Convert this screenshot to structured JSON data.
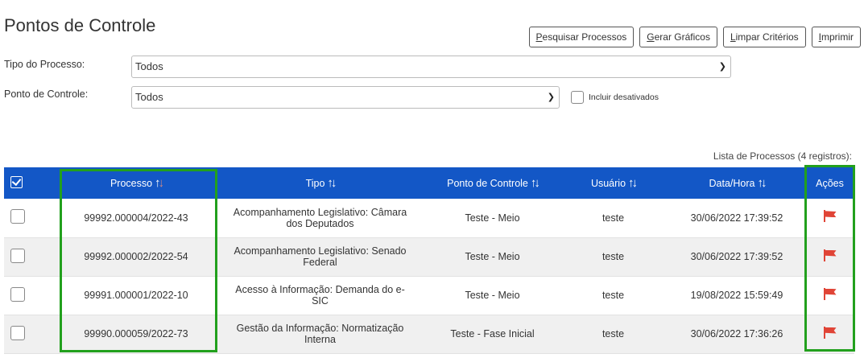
{
  "page": {
    "title": "Pontos de Controle"
  },
  "toolbar": {
    "buttons": [
      {
        "key": "P",
        "rest": "esquisar Processos",
        "name": "search-processes-button"
      },
      {
        "key": "G",
        "rest": "erar Gráficos",
        "name": "generate-charts-button"
      },
      {
        "key": "L",
        "rest": "impar Critérios",
        "name": "clear-criteria-button"
      },
      {
        "key": "I",
        "rest": "mprimir",
        "name": "print-button"
      }
    ]
  },
  "filters": {
    "tipo_label": "Tipo do Processo:",
    "tipo_value": "Todos",
    "ponto_label": "Ponto de Controle:",
    "ponto_value": "Todos",
    "include_disabled_label": "Incluir desativados"
  },
  "table": {
    "caption": "Lista de Processos (4 registros):",
    "headers": {
      "processo": "Processo",
      "tipo": "Tipo",
      "ponto": "Ponto de Controle",
      "usuario": "Usuário",
      "datahora": "Data/Hora",
      "acoes": "Ações"
    },
    "rows": [
      {
        "processo": "99992.000004/2022-43",
        "tipo": "Acompanhamento Legislativo: Câmara dos Deputados",
        "ponto": "Teste - Meio",
        "usuario": "teste",
        "datahora": "30/06/2022 17:39:52"
      },
      {
        "processo": "99992.000002/2022-54",
        "tipo": "Acompanhamento Legislativo: Senado Federal",
        "ponto": "Teste - Meio",
        "usuario": "teste",
        "datahora": "30/06/2022 17:39:52"
      },
      {
        "processo": "99991.000001/2022-10",
        "tipo": "Acesso à Informação: Demanda do e-SIC",
        "ponto": "Teste - Meio",
        "usuario": "teste",
        "datahora": "19/08/2022 15:59:49"
      },
      {
        "processo": "99990.000059/2022-73",
        "tipo": "Gestão da Informação: Normatização Interna",
        "ponto": "Teste - Fase Inicial",
        "usuario": "teste",
        "datahora": "30/06/2022 17:36:26"
      }
    ]
  },
  "colors": {
    "header": "#1357c6",
    "highlight": "#22a01d",
    "flag": "#e04436"
  },
  "icons": {
    "row_action": "flag-icon",
    "select_all": "checkbox-checked-icon",
    "sort": "sort-arrows-icon"
  }
}
